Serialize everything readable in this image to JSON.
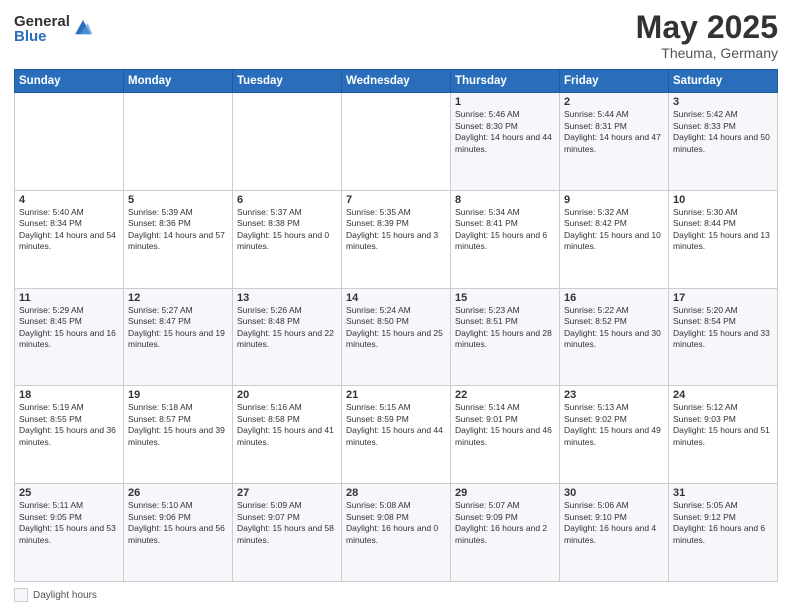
{
  "header": {
    "logo_general": "General",
    "logo_blue": "Blue",
    "month": "May 2025",
    "location": "Theuma, Germany"
  },
  "weekdays": [
    "Sunday",
    "Monday",
    "Tuesday",
    "Wednesday",
    "Thursday",
    "Friday",
    "Saturday"
  ],
  "weeks": [
    [
      {
        "day": "",
        "info": ""
      },
      {
        "day": "",
        "info": ""
      },
      {
        "day": "",
        "info": ""
      },
      {
        "day": "",
        "info": ""
      },
      {
        "day": "1",
        "info": "Sunrise: 5:46 AM\nSunset: 8:30 PM\nDaylight: 14 hours and 44 minutes."
      },
      {
        "day": "2",
        "info": "Sunrise: 5:44 AM\nSunset: 8:31 PM\nDaylight: 14 hours and 47 minutes."
      },
      {
        "day": "3",
        "info": "Sunrise: 5:42 AM\nSunset: 8:33 PM\nDaylight: 14 hours and 50 minutes."
      }
    ],
    [
      {
        "day": "4",
        "info": "Sunrise: 5:40 AM\nSunset: 8:34 PM\nDaylight: 14 hours and 54 minutes."
      },
      {
        "day": "5",
        "info": "Sunrise: 5:39 AM\nSunset: 8:36 PM\nDaylight: 14 hours and 57 minutes."
      },
      {
        "day": "6",
        "info": "Sunrise: 5:37 AM\nSunset: 8:38 PM\nDaylight: 15 hours and 0 minutes."
      },
      {
        "day": "7",
        "info": "Sunrise: 5:35 AM\nSunset: 8:39 PM\nDaylight: 15 hours and 3 minutes."
      },
      {
        "day": "8",
        "info": "Sunrise: 5:34 AM\nSunset: 8:41 PM\nDaylight: 15 hours and 6 minutes."
      },
      {
        "day": "9",
        "info": "Sunrise: 5:32 AM\nSunset: 8:42 PM\nDaylight: 15 hours and 10 minutes."
      },
      {
        "day": "10",
        "info": "Sunrise: 5:30 AM\nSunset: 8:44 PM\nDaylight: 15 hours and 13 minutes."
      }
    ],
    [
      {
        "day": "11",
        "info": "Sunrise: 5:29 AM\nSunset: 8:45 PM\nDaylight: 15 hours and 16 minutes."
      },
      {
        "day": "12",
        "info": "Sunrise: 5:27 AM\nSunset: 8:47 PM\nDaylight: 15 hours and 19 minutes."
      },
      {
        "day": "13",
        "info": "Sunrise: 5:26 AM\nSunset: 8:48 PM\nDaylight: 15 hours and 22 minutes."
      },
      {
        "day": "14",
        "info": "Sunrise: 5:24 AM\nSunset: 8:50 PM\nDaylight: 15 hours and 25 minutes."
      },
      {
        "day": "15",
        "info": "Sunrise: 5:23 AM\nSunset: 8:51 PM\nDaylight: 15 hours and 28 minutes."
      },
      {
        "day": "16",
        "info": "Sunrise: 5:22 AM\nSunset: 8:52 PM\nDaylight: 15 hours and 30 minutes."
      },
      {
        "day": "17",
        "info": "Sunrise: 5:20 AM\nSunset: 8:54 PM\nDaylight: 15 hours and 33 minutes."
      }
    ],
    [
      {
        "day": "18",
        "info": "Sunrise: 5:19 AM\nSunset: 8:55 PM\nDaylight: 15 hours and 36 minutes."
      },
      {
        "day": "19",
        "info": "Sunrise: 5:18 AM\nSunset: 8:57 PM\nDaylight: 15 hours and 39 minutes."
      },
      {
        "day": "20",
        "info": "Sunrise: 5:16 AM\nSunset: 8:58 PM\nDaylight: 15 hours and 41 minutes."
      },
      {
        "day": "21",
        "info": "Sunrise: 5:15 AM\nSunset: 8:59 PM\nDaylight: 15 hours and 44 minutes."
      },
      {
        "day": "22",
        "info": "Sunrise: 5:14 AM\nSunset: 9:01 PM\nDaylight: 15 hours and 46 minutes."
      },
      {
        "day": "23",
        "info": "Sunrise: 5:13 AM\nSunset: 9:02 PM\nDaylight: 15 hours and 49 minutes."
      },
      {
        "day": "24",
        "info": "Sunrise: 5:12 AM\nSunset: 9:03 PM\nDaylight: 15 hours and 51 minutes."
      }
    ],
    [
      {
        "day": "25",
        "info": "Sunrise: 5:11 AM\nSunset: 9:05 PM\nDaylight: 15 hours and 53 minutes."
      },
      {
        "day": "26",
        "info": "Sunrise: 5:10 AM\nSunset: 9:06 PM\nDaylight: 15 hours and 56 minutes."
      },
      {
        "day": "27",
        "info": "Sunrise: 5:09 AM\nSunset: 9:07 PM\nDaylight: 15 hours and 58 minutes."
      },
      {
        "day": "28",
        "info": "Sunrise: 5:08 AM\nSunset: 9:08 PM\nDaylight: 16 hours and 0 minutes."
      },
      {
        "day": "29",
        "info": "Sunrise: 5:07 AM\nSunset: 9:09 PM\nDaylight: 16 hours and 2 minutes."
      },
      {
        "day": "30",
        "info": "Sunrise: 5:06 AM\nSunset: 9:10 PM\nDaylight: 16 hours and 4 minutes."
      },
      {
        "day": "31",
        "info": "Sunrise: 5:05 AM\nSunset: 9:12 PM\nDaylight: 16 hours and 6 minutes."
      }
    ]
  ],
  "footer": {
    "label": "Daylight hours"
  }
}
